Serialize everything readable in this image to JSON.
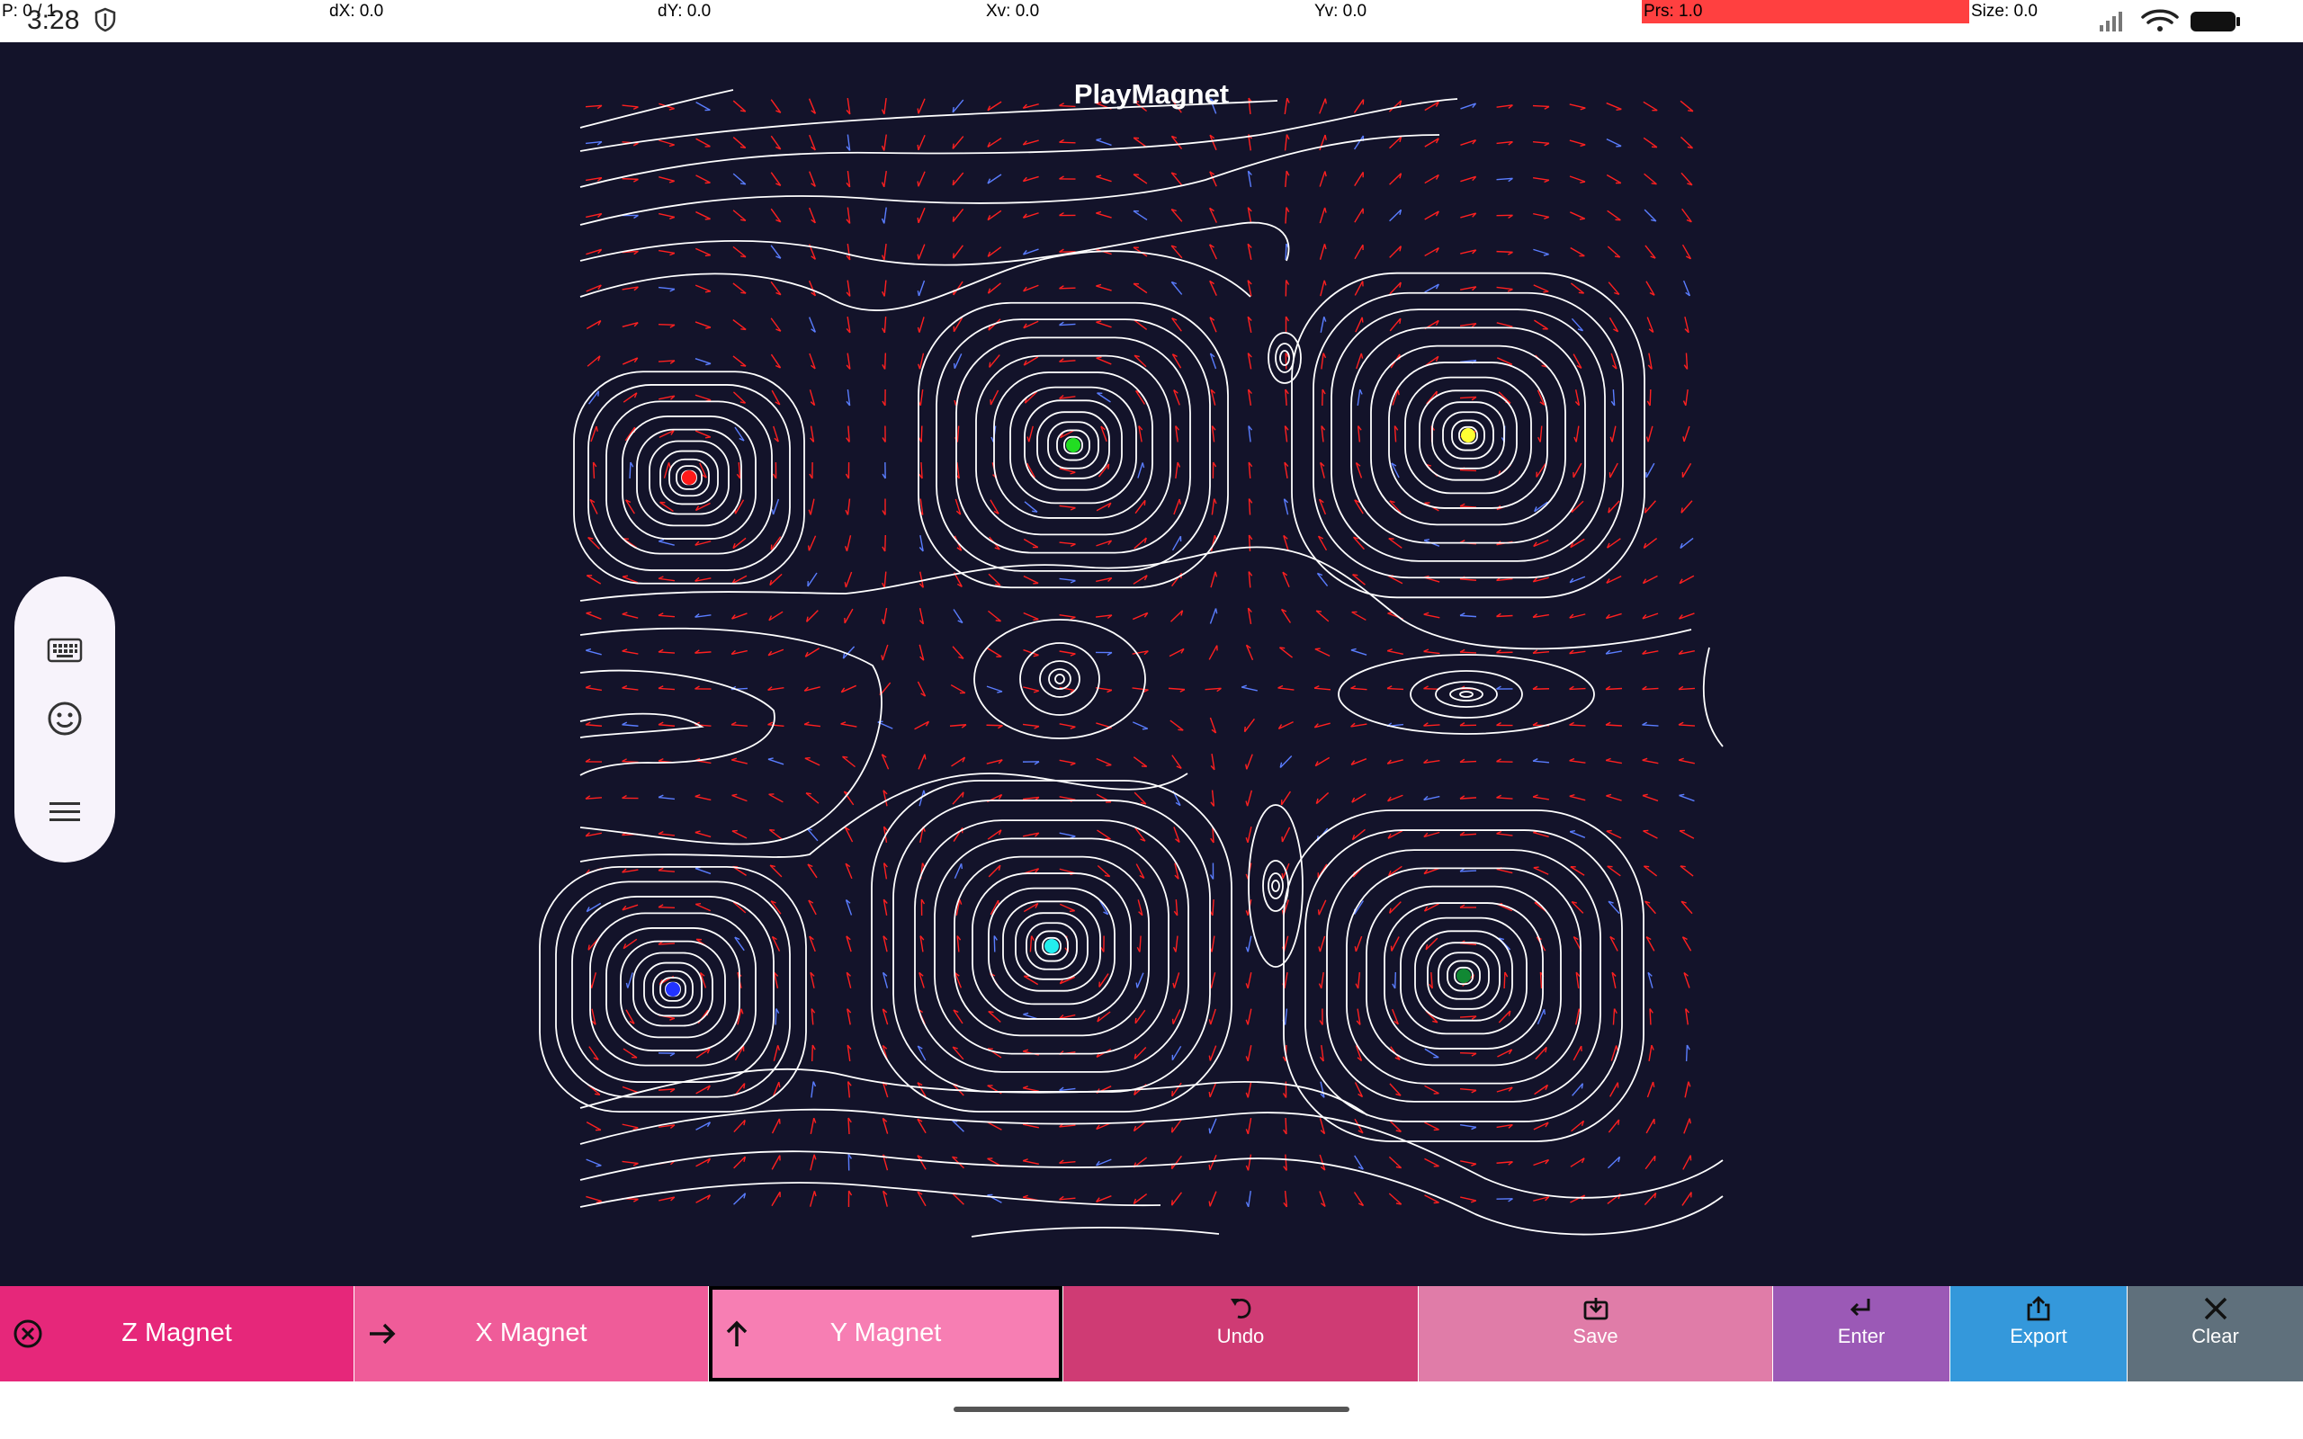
{
  "status_bar": {
    "time": "3:28",
    "readouts": [
      {
        "key": "p",
        "text": "P: 0 / 1"
      },
      {
        "key": "dx",
        "text": "dX: 0.0"
      },
      {
        "key": "dy",
        "text": "dY: 0.0"
      },
      {
        "key": "xv",
        "text": "Xv: 0.0"
      },
      {
        "key": "yv",
        "text": "Yv: 0.0"
      },
      {
        "key": "prs",
        "text": "Prs: 1.0"
      },
      {
        "key": "size",
        "text": "Size: 0.0"
      }
    ],
    "prs_bar_color": "#ff4040",
    "icons": [
      "shield-icon",
      "signal-icon",
      "wifi-icon",
      "battery-icon"
    ]
  },
  "canvas": {
    "title": "PlayMagnet",
    "background": "#13132a",
    "magnets": [
      {
        "name": "red",
        "color": "#ff1a1a"
      },
      {
        "name": "green",
        "color": "#22dd22"
      },
      {
        "name": "yellow",
        "color": "#ffff33"
      },
      {
        "name": "blue",
        "color": "#2233ff"
      },
      {
        "name": "cyan",
        "color": "#22eeee"
      },
      {
        "name": "dark-green",
        "color": "#118833"
      }
    ],
    "field_line_color": "#ffffff",
    "arrow_colors": [
      "#ff2020",
      "#5a7dff"
    ]
  },
  "side_panel": {
    "icons": [
      "keyboard-icon",
      "emoji-icon",
      "menu-icon"
    ]
  },
  "toolbar": {
    "z_magnet": {
      "label": "Z Magnet",
      "color": "#e6277a",
      "icon": "close-circle-icon"
    },
    "x_magnet": {
      "label": "X Magnet",
      "color": "#ef5c99",
      "icon": "arrow-right-icon"
    },
    "y_magnet": {
      "label": "Y Magnet",
      "color": "#f77eb3",
      "icon": "arrow-up-icon",
      "selected": true
    },
    "undo": {
      "label": "Undo",
      "color": "#cf3b74",
      "icon": "undo-icon"
    },
    "save": {
      "label": "Save",
      "color": "#e07ca8",
      "icon": "save-icon"
    },
    "enter": {
      "label": "Enter",
      "color": "#9b59b6",
      "icon": "enter-icon"
    },
    "export": {
      "label": "Export",
      "color": "#3498db",
      "icon": "export-icon"
    },
    "clear": {
      "label": "Clear",
      "color": "#5f707c",
      "icon": "close-icon"
    }
  }
}
